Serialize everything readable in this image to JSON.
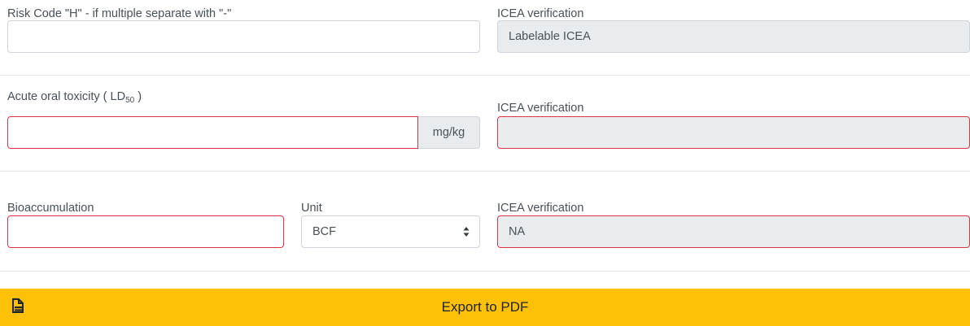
{
  "risk_code": {
    "label": "Risk Code \"H\" - if multiple separate with \"-\"",
    "value": "",
    "icea_label": "ICEA verification",
    "icea_value": "Labelable ICEA"
  },
  "acute_toxicity": {
    "label_prefix": "Acute oral toxicity ( LD",
    "label_sub": "50",
    "label_suffix": " )",
    "value": "",
    "unit_addon": "mg/kg",
    "icea_label": "ICEA verification",
    "icea_value": ""
  },
  "bioaccumulation": {
    "label": "Bioaccumulation",
    "value": "",
    "unit_label": "Unit",
    "unit_selected": "BCF",
    "icea_label": "ICEA verification",
    "icea_value": "NA"
  },
  "export": {
    "label": "Export to PDF",
    "icon": "pdf-file-icon"
  },
  "colors": {
    "invalid_border": "#dc3545",
    "readonly_bg": "#e9ecef",
    "export_bg": "#ffc107"
  }
}
